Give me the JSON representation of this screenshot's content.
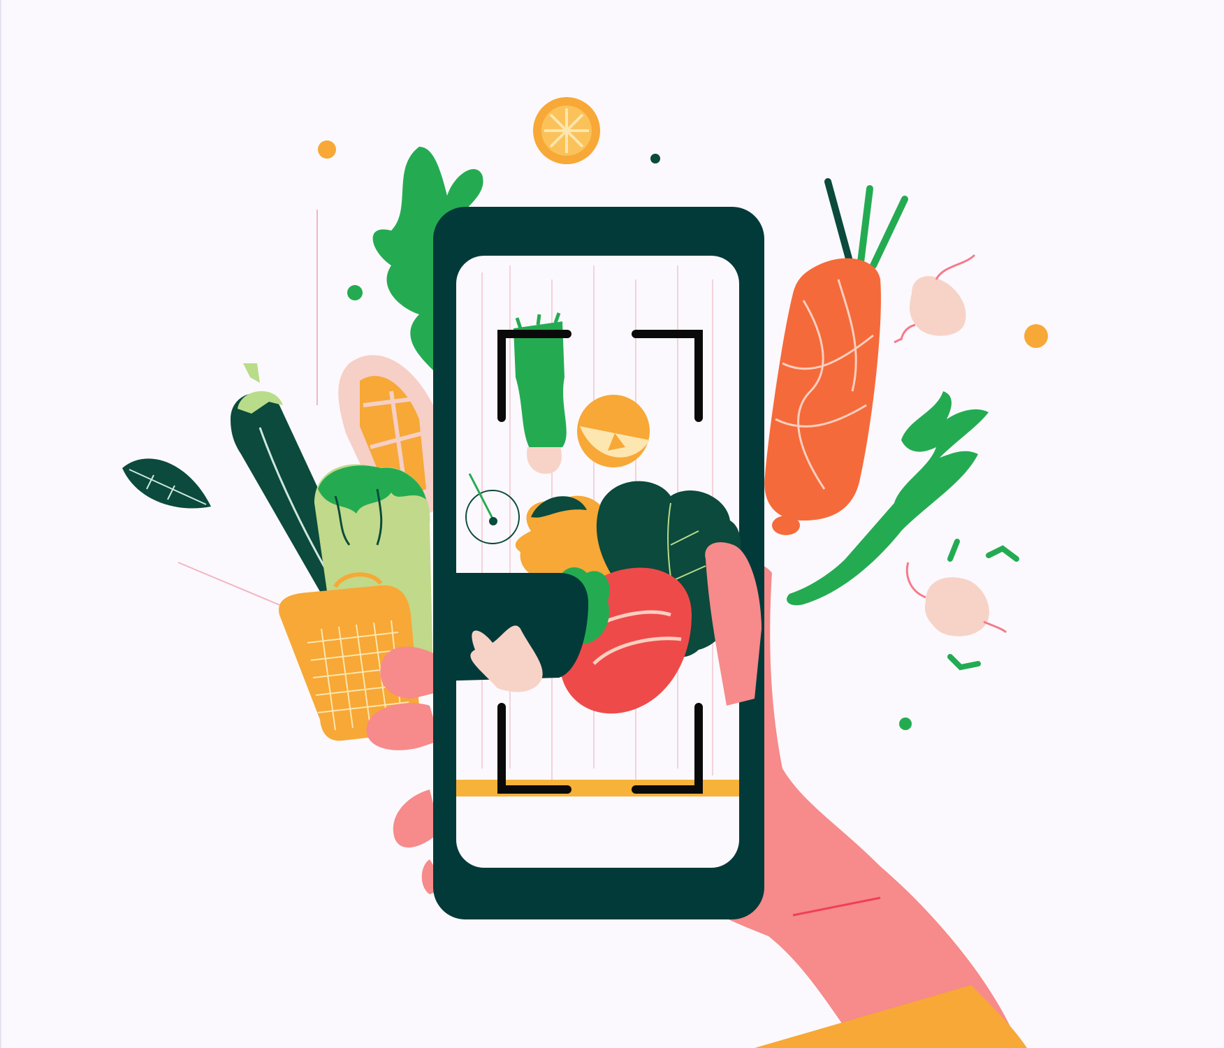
{
  "illustration": {
    "subject": "hand-holding-phone-scanning-vegetables",
    "icons": [
      "orange-slice-icon",
      "leaf-icon",
      "eggplant-icon",
      "corn-icon",
      "carrot-icon",
      "radish-icon",
      "tomato-icon",
      "broccoli-icon",
      "lettuce-icon",
      "scan-frame-icon"
    ],
    "colors": {
      "background": "#fbf9fd",
      "phone_body": "#023a3a",
      "screen": "#fbf9fd",
      "scan_line": "#f7b23a",
      "scan_corners": "#0a0a0a",
      "hand": "#f78a8a",
      "sleeve": "#f7a836",
      "carrot": "#f56a3a",
      "leaf_green": "#24ab52",
      "dark_green": "#0b4a3c",
      "orange": "#f7a836",
      "tomato": "#ef4a4a",
      "radish": "#f7d3c7"
    }
  }
}
